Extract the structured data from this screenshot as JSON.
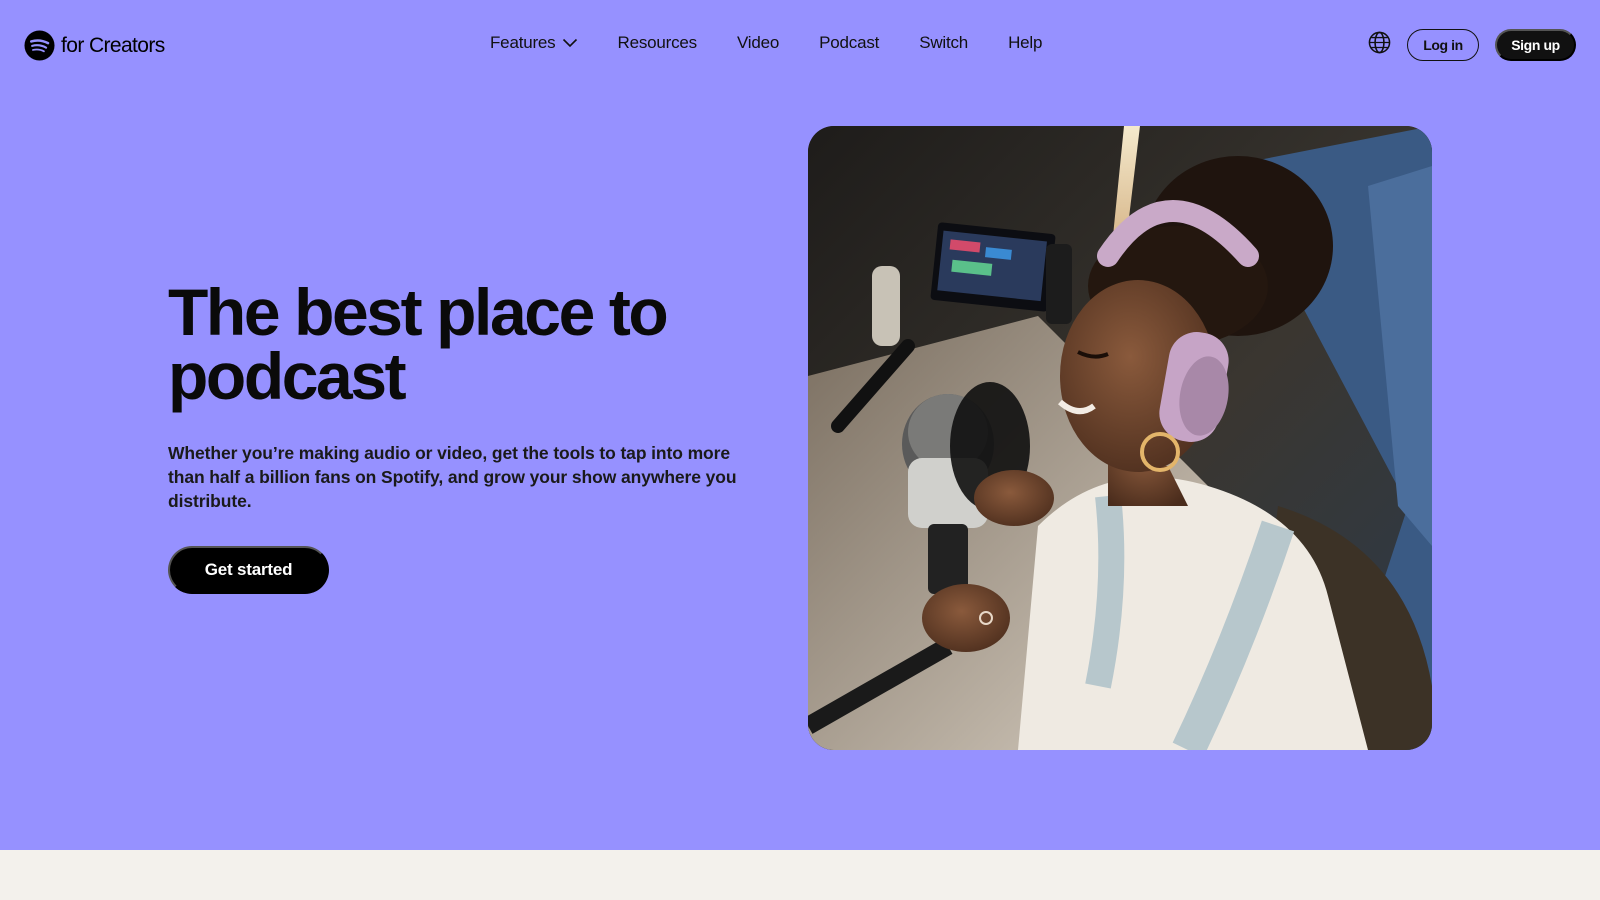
{
  "header": {
    "logo_text": "for Creators",
    "nav": [
      {
        "label": "Features"
      },
      {
        "label": "Resources"
      },
      {
        "label": "Video"
      },
      {
        "label": "Podcast"
      },
      {
        "label": "Switch"
      },
      {
        "label": "Help"
      }
    ],
    "login_label": "Log in",
    "signup_label": "Sign up",
    "icons": {
      "logo": "spotify-logo-icon",
      "features_dropdown": "chevron-down-icon",
      "language": "globe-icon"
    }
  },
  "hero": {
    "headline": "The best place to podcast",
    "subtext": "Whether you’re making audio or video, get the tools to tap into more than half a billion fans on Spotify, and grow your show anywhere you distribute.",
    "cta_label": "Get started"
  },
  "colors": {
    "hero_background": "#9691ff",
    "footer_band": "#f3f1ec",
    "primary_button": "#000000",
    "button_text": "#ffffff"
  }
}
